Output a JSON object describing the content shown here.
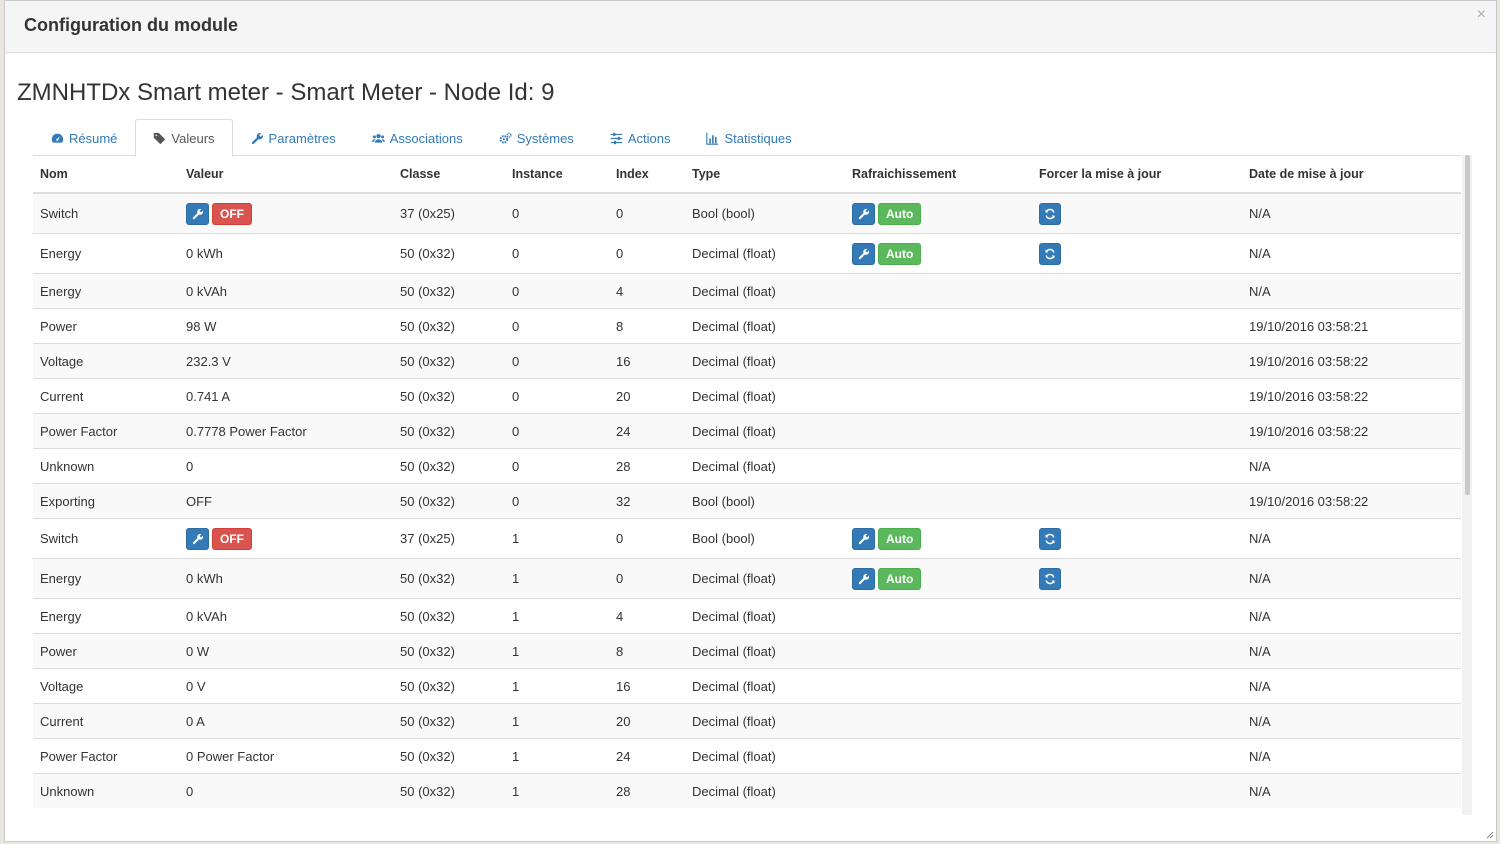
{
  "modal": {
    "title": "Configuration du module",
    "close_label": "×"
  },
  "node_title": "ZMNHTDx Smart meter - Smart Meter - Node Id: 9",
  "tabs": [
    {
      "label": "Résumé",
      "icon": "dashboard-icon"
    },
    {
      "label": "Valeurs",
      "icon": "tag-icon",
      "active": true
    },
    {
      "label": "Paramètres",
      "icon": "wrench-icon"
    },
    {
      "label": "Associations",
      "icon": "users-icon"
    },
    {
      "label": "Systèmes",
      "icon": "cogs-icon"
    },
    {
      "label": "Actions",
      "icon": "sliders-icon"
    },
    {
      "label": "Statistiques",
      "icon": "bar-chart-icon"
    }
  ],
  "table": {
    "headers": [
      "Nom",
      "Valeur",
      "Classe",
      "Instance",
      "Index",
      "Type",
      "Rafraichissement",
      "Forcer la mise à jour",
      "Date de mise à jour"
    ],
    "auto_label": "Auto",
    "off_label": "OFF",
    "rows": [
      {
        "name": "Switch",
        "value": "",
        "toggle": "OFF",
        "classe": "37 (0x25)",
        "instance": "0",
        "index": "0",
        "type": "Bool (bool)",
        "refresh": true,
        "date": "N/A"
      },
      {
        "name": "Energy",
        "value": "0 kWh",
        "classe": "50 (0x32)",
        "instance": "0",
        "index": "0",
        "type": "Decimal (float)",
        "refresh": true,
        "date": "N/A"
      },
      {
        "name": "Energy",
        "value": "0 kVAh",
        "classe": "50 (0x32)",
        "instance": "0",
        "index": "4",
        "type": "Decimal (float)",
        "refresh": false,
        "date": "N/A"
      },
      {
        "name": "Power",
        "value": "98 W",
        "classe": "50 (0x32)",
        "instance": "0",
        "index": "8",
        "type": "Decimal (float)",
        "refresh": false,
        "date": "19/10/2016 03:58:21"
      },
      {
        "name": "Voltage",
        "value": "232.3 V",
        "classe": "50 (0x32)",
        "instance": "0",
        "index": "16",
        "type": "Decimal (float)",
        "refresh": false,
        "date": "19/10/2016 03:58:22"
      },
      {
        "name": "Current",
        "value": "0.741 A",
        "classe": "50 (0x32)",
        "instance": "0",
        "index": "20",
        "type": "Decimal (float)",
        "refresh": false,
        "date": "19/10/2016 03:58:22"
      },
      {
        "name": "Power Factor",
        "value": "0.7778 Power Factor",
        "classe": "50 (0x32)",
        "instance": "0",
        "index": "24",
        "type": "Decimal (float)",
        "refresh": false,
        "date": "19/10/2016 03:58:22"
      },
      {
        "name": "Unknown",
        "value": "0",
        "classe": "50 (0x32)",
        "instance": "0",
        "index": "28",
        "type": "Decimal (float)",
        "refresh": false,
        "date": "N/A"
      },
      {
        "name": "Exporting",
        "value": "OFF",
        "classe": "50 (0x32)",
        "instance": "0",
        "index": "32",
        "type": "Bool (bool)",
        "refresh": false,
        "date": "19/10/2016 03:58:22"
      },
      {
        "name": "Switch",
        "value": "",
        "toggle": "OFF",
        "classe": "37 (0x25)",
        "instance": "1",
        "index": "0",
        "type": "Bool (bool)",
        "refresh": true,
        "date": "N/A"
      },
      {
        "name": "Energy",
        "value": "0 kWh",
        "classe": "50 (0x32)",
        "instance": "1",
        "index": "0",
        "type": "Decimal (float)",
        "refresh": true,
        "date": "N/A"
      },
      {
        "name": "Energy",
        "value": "0 kVAh",
        "classe": "50 (0x32)",
        "instance": "1",
        "index": "4",
        "type": "Decimal (float)",
        "refresh": false,
        "date": "N/A"
      },
      {
        "name": "Power",
        "value": "0 W",
        "classe": "50 (0x32)",
        "instance": "1",
        "index": "8",
        "type": "Decimal (float)",
        "refresh": false,
        "date": "N/A"
      },
      {
        "name": "Voltage",
        "value": "0 V",
        "classe": "50 (0x32)",
        "instance": "1",
        "index": "16",
        "type": "Decimal (float)",
        "refresh": false,
        "date": "N/A"
      },
      {
        "name": "Current",
        "value": "0 A",
        "classe": "50 (0x32)",
        "instance": "1",
        "index": "20",
        "type": "Decimal (float)",
        "refresh": false,
        "date": "N/A"
      },
      {
        "name": "Power Factor",
        "value": "0 Power Factor",
        "classe": "50 (0x32)",
        "instance": "1",
        "index": "24",
        "type": "Decimal (float)",
        "refresh": false,
        "date": "N/A"
      },
      {
        "name": "Unknown",
        "value": "0",
        "classe": "50 (0x32)",
        "instance": "1",
        "index": "28",
        "type": "Decimal (float)",
        "refresh": false,
        "date": "N/A"
      }
    ]
  },
  "colors": {
    "primary": "#337ab7",
    "danger": "#d9534f",
    "success": "#5cb85c"
  }
}
